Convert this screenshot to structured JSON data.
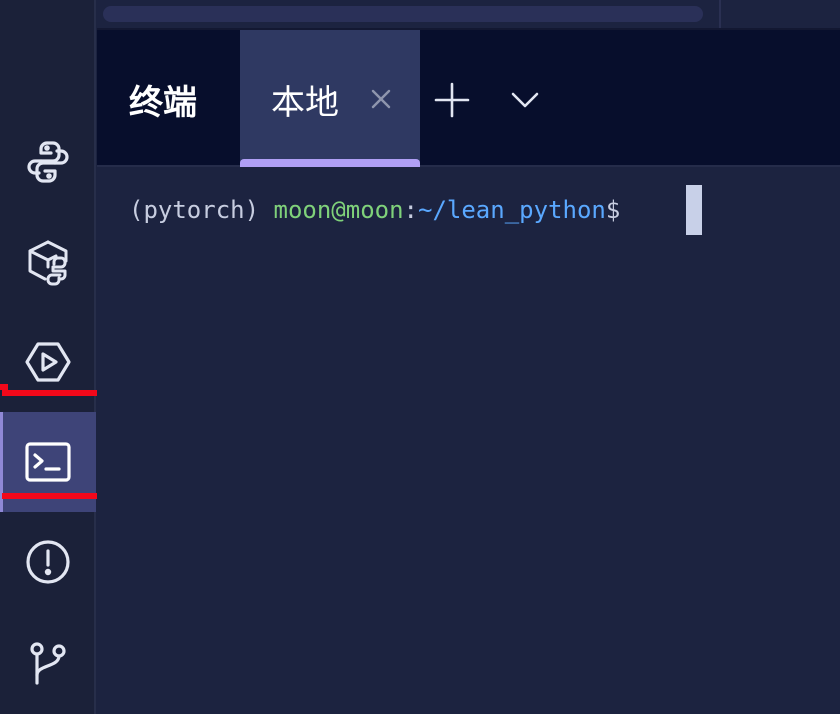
{
  "activity_bar": {
    "items": [
      {
        "name": "python",
        "icon": "python-icon"
      },
      {
        "name": "packages",
        "icon": "python-package-icon"
      },
      {
        "name": "run",
        "icon": "run-hexagon-icon"
      },
      {
        "name": "terminal",
        "icon": "terminal-icon",
        "active": true
      },
      {
        "name": "problems",
        "icon": "alert-circle-icon"
      },
      {
        "name": "git",
        "icon": "git-branch-icon"
      }
    ]
  },
  "panel": {
    "title": "终端",
    "tabs": [
      {
        "label": "本地",
        "active": true
      }
    ],
    "add_icon": "plus-icon",
    "dropdown_icon": "chevron-down-icon"
  },
  "terminal": {
    "env": "(pytorch) ",
    "user_host": "moon@moon",
    "colon": ":",
    "path": "~/lean_python",
    "dollar": "$ "
  },
  "colors": {
    "accent_underline": "#b09ff5",
    "highlight": "#f2081a",
    "user_green": "#7fd17a",
    "path_blue": "#5aa8ff"
  }
}
